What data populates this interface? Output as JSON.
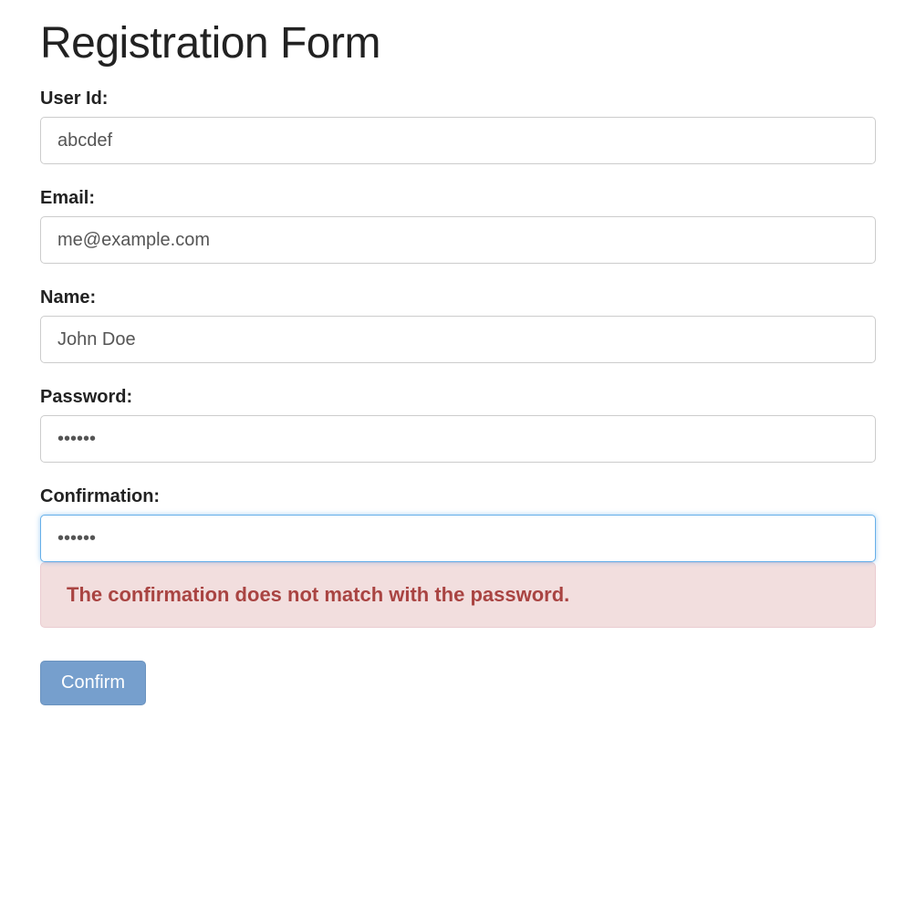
{
  "title": "Registration Form",
  "fields": {
    "userId": {
      "label": "User Id:",
      "value": "abcdef"
    },
    "email": {
      "label": "Email:",
      "value": "me@example.com"
    },
    "name": {
      "label": "Name:",
      "value": "John Doe"
    },
    "password": {
      "label": "Password:",
      "value": "••••••"
    },
    "confirmation": {
      "label": "Confirmation:",
      "value": "••••••"
    }
  },
  "error": {
    "message": "The confirmation does not match with the password."
  },
  "buttons": {
    "confirm": "Confirm"
  }
}
